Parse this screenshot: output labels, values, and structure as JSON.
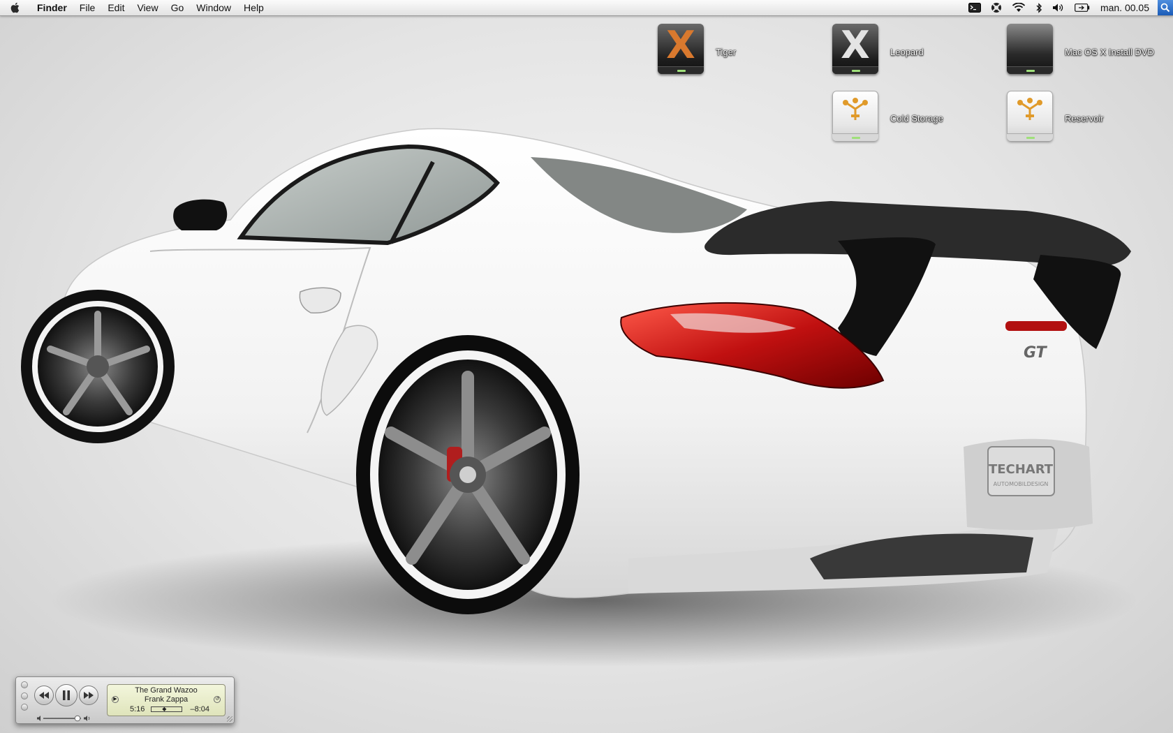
{
  "menubar": {
    "app_name": "Finder",
    "menus": [
      "File",
      "Edit",
      "View",
      "Go",
      "Window",
      "Help"
    ],
    "status_icons": [
      "terminal-icon",
      "lifebuoy-icon",
      "wifi-icon",
      "bluetooth-icon",
      "volume-icon",
      "battery-icon"
    ],
    "clock": "man. 00.05",
    "spotlight_icon": "spotlight-icon"
  },
  "desktop": {
    "icons": [
      {
        "label": "Tiger",
        "kind": "dark-drive-x-orange"
      },
      {
        "label": "Leopard",
        "kind": "dark-drive-x-silver"
      },
      {
        "label": "Mac OS X Install DVD",
        "kind": "dark-drive"
      },
      {
        "label": "Cold Storage",
        "kind": "firewire-drive"
      },
      {
        "label": "Reservoir",
        "kind": "firewire-drive"
      }
    ]
  },
  "wallpaper": {
    "badge": "GT",
    "plate_line1": "TECHART",
    "plate_line2": "AUTOMOBILDESIGN"
  },
  "player": {
    "song": "The Grand Wazoo",
    "artist": "Frank Zappa",
    "elapsed": "5:16",
    "remaining": "–8:04",
    "progress": 0.4
  }
}
